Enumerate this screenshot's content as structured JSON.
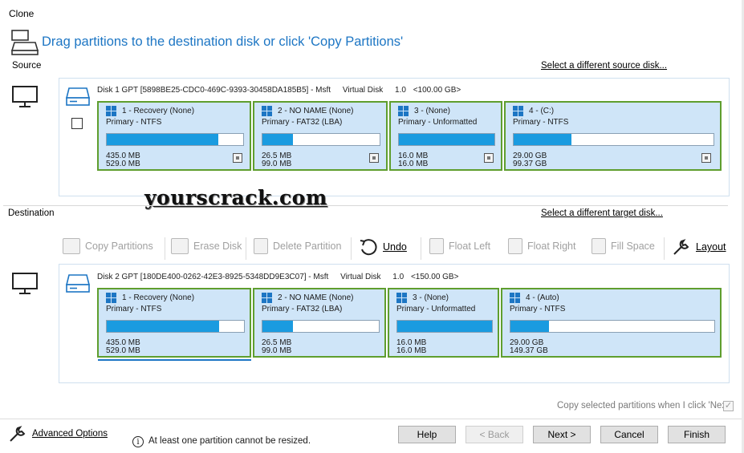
{
  "window": {
    "title": "Clone"
  },
  "header": {
    "text": "Drag partitions to the destination disk or click 'Copy Partitions'"
  },
  "source": {
    "label": "Source",
    "change_link": "Select a different source disk...",
    "disk": {
      "name": "Disk 1 GPT [5898BE25-CDC0-469C-9393-30458DA185B5] - Msft",
      "type": "Virtual Disk",
      "version": "1.0",
      "size": "<100.00 GB>"
    },
    "partitions": [
      {
        "title": "1 - Recovery (None)",
        "sub": "Primary - NTFS",
        "used": "435.0 MB",
        "total": "529.0 MB",
        "fill": 0.82
      },
      {
        "title": "2 - NO NAME (None)",
        "sub": "Primary - FAT32 (LBA)",
        "used": "26.5 MB",
        "total": "99.0 MB",
        "fill": 0.26
      },
      {
        "title": "3 - (None)",
        "sub": "Primary - Unformatted",
        "used": "16.0 MB",
        "total": "16.0 MB",
        "fill": 1.0
      },
      {
        "title": "4 - (C:)",
        "sub": "Primary - NTFS",
        "used": "29.00 GB",
        "total": "99.37 GB",
        "fill": 0.29
      }
    ]
  },
  "watermark": "yourscrack.com",
  "destination": {
    "label": "Destination",
    "change_link": "Select a different target disk...",
    "disk": {
      "name": "Disk 2 GPT [180DE400-0262-42E3-8925-5348DD9E3C07] - Msft",
      "type": "Virtual Disk",
      "version": "1.0",
      "size": "<150.00 GB>"
    },
    "partitions": [
      {
        "title": "1 - Recovery (None)",
        "sub": "Primary - NTFS",
        "used": "435.0 MB",
        "total": "529.0 MB",
        "fill": 0.82
      },
      {
        "title": "2 - NO NAME (None)",
        "sub": "Primary - FAT32 (LBA)",
        "used": "26.5 MB",
        "total": "99.0 MB",
        "fill": 0.26
      },
      {
        "title": "3 - (None)",
        "sub": "Primary - Unformatted",
        "used": "16.0 MB",
        "total": "16.0 MB",
        "fill": 1.0
      },
      {
        "title": "4 - (Auto)",
        "sub": "Primary - NTFS",
        "used": "29.00 GB",
        "total": "149.37 GB",
        "fill": 0.19
      }
    ]
  },
  "toolbar": {
    "copy_partitions": "Copy Partitions",
    "erase_disk": "Erase Disk",
    "delete_partition": "Delete Partition",
    "undo": "Undo",
    "float_left": "Float Left",
    "float_right": "Float Right",
    "fill_space": "Fill Space",
    "layout": "Layout"
  },
  "copy_option": {
    "label": "Copy selected partitions when I click 'Next'",
    "checked": true
  },
  "footer": {
    "advanced": "Advanced Options",
    "warning": "At least one partition cannot be resized.",
    "help": "Help",
    "back": "< Back",
    "next": "Next >",
    "cancel": "Cancel",
    "finish": "Finish"
  },
  "colors": {
    "accent": "#1d76c4",
    "partition_bg": "#cfe5f8",
    "partition_border": "#5f9e2e",
    "bar_fill": "#1a9be0"
  }
}
